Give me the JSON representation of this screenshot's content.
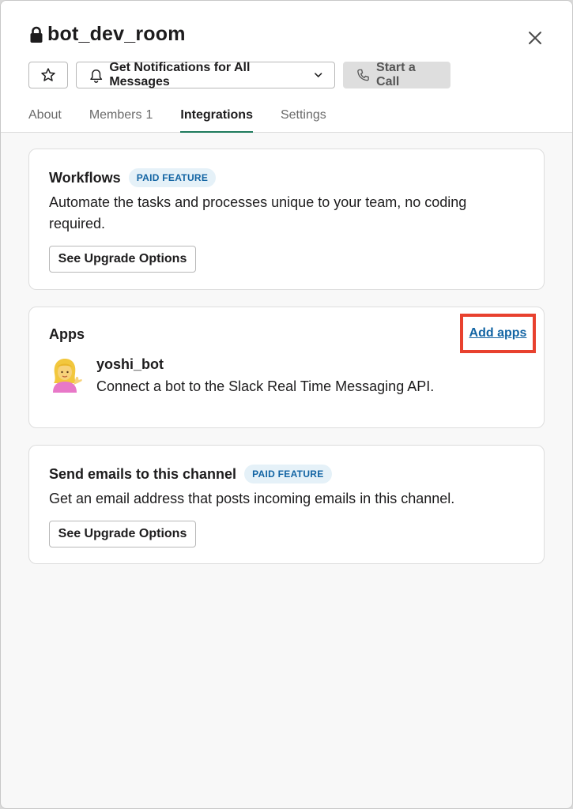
{
  "channel": {
    "title": "bot_dev_room",
    "private": true
  },
  "header": {
    "notifications_label": "Get Notifications for All Messages",
    "call_label": "Start a Call"
  },
  "tabs": [
    {
      "label": "About"
    },
    {
      "label": "Members",
      "count": "1"
    },
    {
      "label": "Integrations",
      "active": true
    },
    {
      "label": "Settings"
    }
  ],
  "workflows": {
    "title": "Workflows",
    "badge": "PAID FEATURE",
    "description": "Automate the tasks and processes unique to your team, no coding required.",
    "button": "See Upgrade Options"
  },
  "apps": {
    "title": "Apps",
    "add_link": "Add apps",
    "items": [
      {
        "name": "yoshi_bot",
        "description": "Connect a bot to the Slack Real Time Messaging API.",
        "icon": "woman-tipping-hand-emoji"
      }
    ]
  },
  "emails": {
    "title": "Send emails to this channel",
    "badge": "PAID FEATURE",
    "description": "Get an email address that posts incoming emails in this channel.",
    "button": "See Upgrade Options"
  },
  "colors": {
    "accent_link": "#1264a3",
    "active_tab_underline": "#1e7a5c",
    "highlight_box": "#e8412e",
    "badge_bg": "#e5f1f8"
  }
}
